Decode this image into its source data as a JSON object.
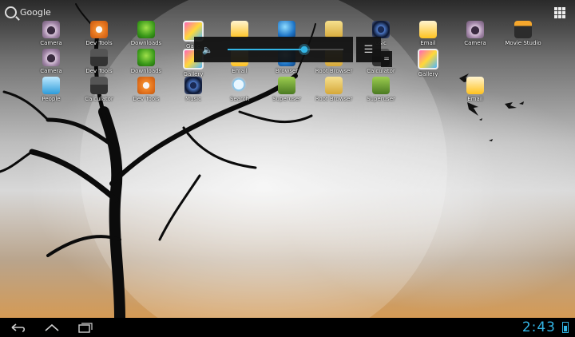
{
  "search": {
    "label": "Google"
  },
  "icons": [
    {
      "label": "Camera",
      "icon": "camera-icon"
    },
    {
      "label": "Dev Tools",
      "icon": "devtools-icon"
    },
    {
      "label": "Downloads",
      "icon": "downloads-icon"
    },
    {
      "label": "Galle",
      "icon": "gallery-icon"
    },
    {
      "label": "",
      "icon": "email-icon"
    },
    {
      "label": "",
      "icon": "browser-icon"
    },
    {
      "label": "",
      "icon": "root-browser-icon"
    },
    {
      "label": "usic",
      "icon": "music-icon"
    },
    {
      "label": "Email",
      "icon": "email-icon"
    },
    {
      "label": "Camera",
      "icon": "camera-icon"
    },
    {
      "label": "Movie Studio",
      "icon": "movie-studio-icon"
    },
    {
      "label": "Camera",
      "icon": "camera-icon"
    },
    {
      "label": "Dev Tools",
      "icon": "calculator-icon"
    },
    {
      "label": "Downloads",
      "icon": "downloads-icon"
    },
    {
      "label": "Gallery",
      "icon": "gallery-icon"
    },
    {
      "label": "Email",
      "icon": "email-icon"
    },
    {
      "label": "Browser",
      "icon": "browser-icon"
    },
    {
      "label": "Root Browser",
      "icon": "root-browser-icon"
    },
    {
      "label": "Calculator",
      "icon": "calculator-icon"
    },
    {
      "label": "Gallery",
      "icon": "gallery-icon"
    },
    {
      "label": "People",
      "icon": "people-icon"
    },
    {
      "label": "Calculator",
      "icon": "calculator-icon"
    },
    {
      "label": "Dev Tools",
      "icon": "devtools-icon"
    },
    {
      "label": "Music",
      "icon": "music-icon"
    },
    {
      "label": "Search",
      "icon": "search-icon"
    },
    {
      "label": "Superuser",
      "icon": "superuser-icon"
    },
    {
      "label": "Root Browser",
      "icon": "root-browser-icon"
    },
    {
      "label": "Superuser",
      "icon": "superuser-icon"
    },
    {
      "label": "Email",
      "icon": "email-icon"
    }
  ],
  "volume": {
    "level": 0.66,
    "accent": "#33b5e5"
  },
  "status": {
    "time": "2:43",
    "accent": "#33b5e5"
  }
}
